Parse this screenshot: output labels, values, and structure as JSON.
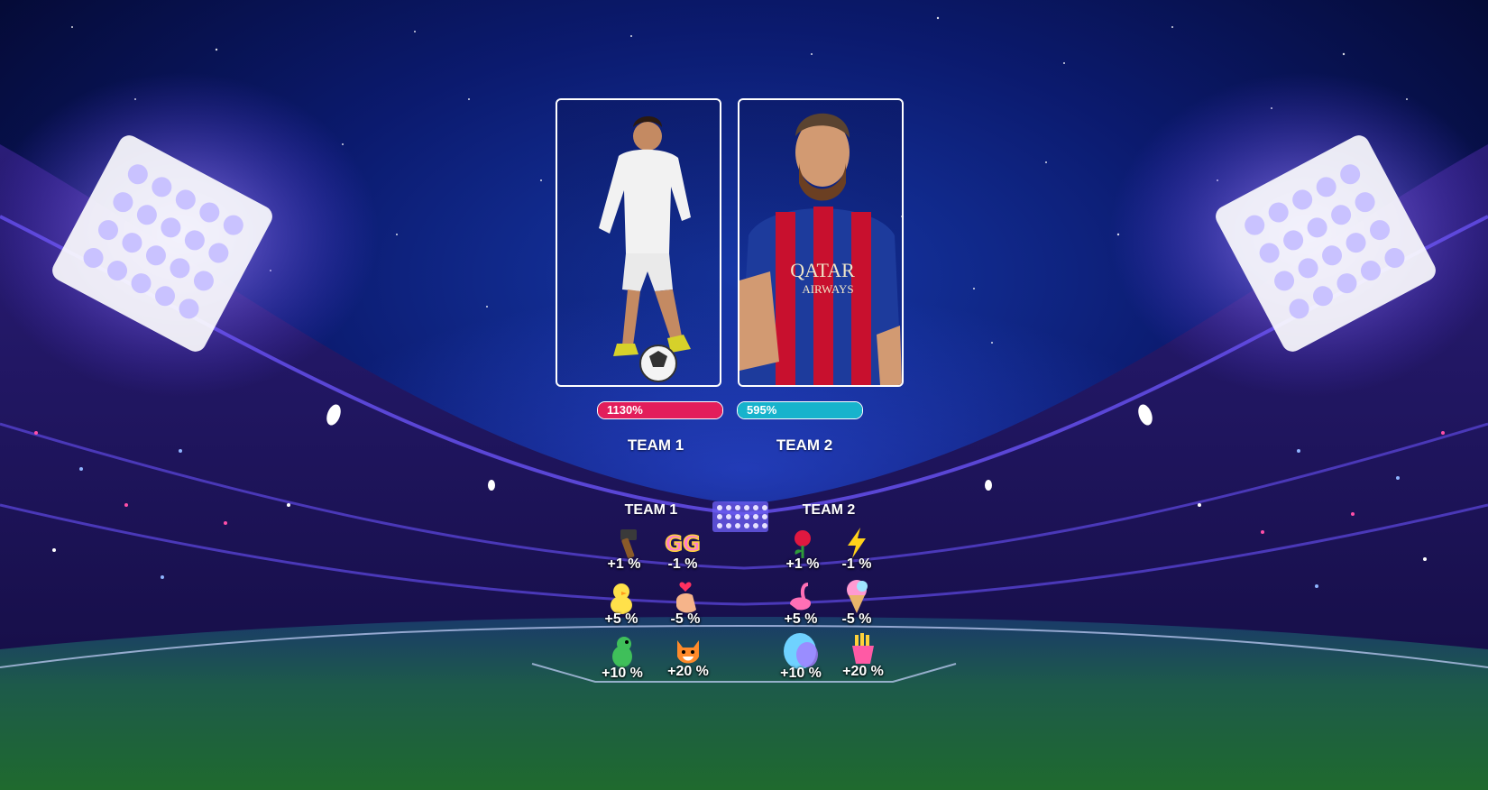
{
  "colors": {
    "team1_bar": "#e21d5b",
    "team2_bar": "#17b3cc",
    "card_border": "#ffffff"
  },
  "players": [
    {
      "team": "TEAM 1",
      "photo_icon": "player-white-kit-icon"
    },
    {
      "team": "TEAM 2",
      "photo_icon": "player-striped-kit-icon"
    }
  ],
  "scores": {
    "team1": {
      "percent_label": "1130%",
      "fill": 1.0
    },
    "team2": {
      "percent_label": "595%",
      "fill": 1.0
    },
    "team1_label": "TEAM 1",
    "team2_label": "TEAM 2"
  },
  "gifts": {
    "team1_header": "TEAM 1",
    "team2_header": "TEAM 2",
    "team1": [
      {
        "icon": "hammer-icon",
        "value": "+1 %"
      },
      {
        "icon": "gg-icon",
        "value": "-1 %"
      },
      {
        "icon": "chick-icon",
        "value": "+5 %"
      },
      {
        "icon": "finger-heart-icon",
        "value": "-5 %"
      },
      {
        "icon": "dinosaur-icon",
        "value": "+10 %"
      },
      {
        "icon": "fox-icon",
        "value": "+20 %"
      }
    ],
    "team2": [
      {
        "icon": "rose-icon",
        "value": "+1 %"
      },
      {
        "icon": "lightning-icon",
        "value": "-1 %"
      },
      {
        "icon": "flamingo-icon",
        "value": "+5 %"
      },
      {
        "icon": "ice-cream-icon",
        "value": "-5 %"
      },
      {
        "icon": "egg-icon",
        "value": "+10 %"
      },
      {
        "icon": "fries-icon",
        "value": "+20 %"
      }
    ]
  }
}
